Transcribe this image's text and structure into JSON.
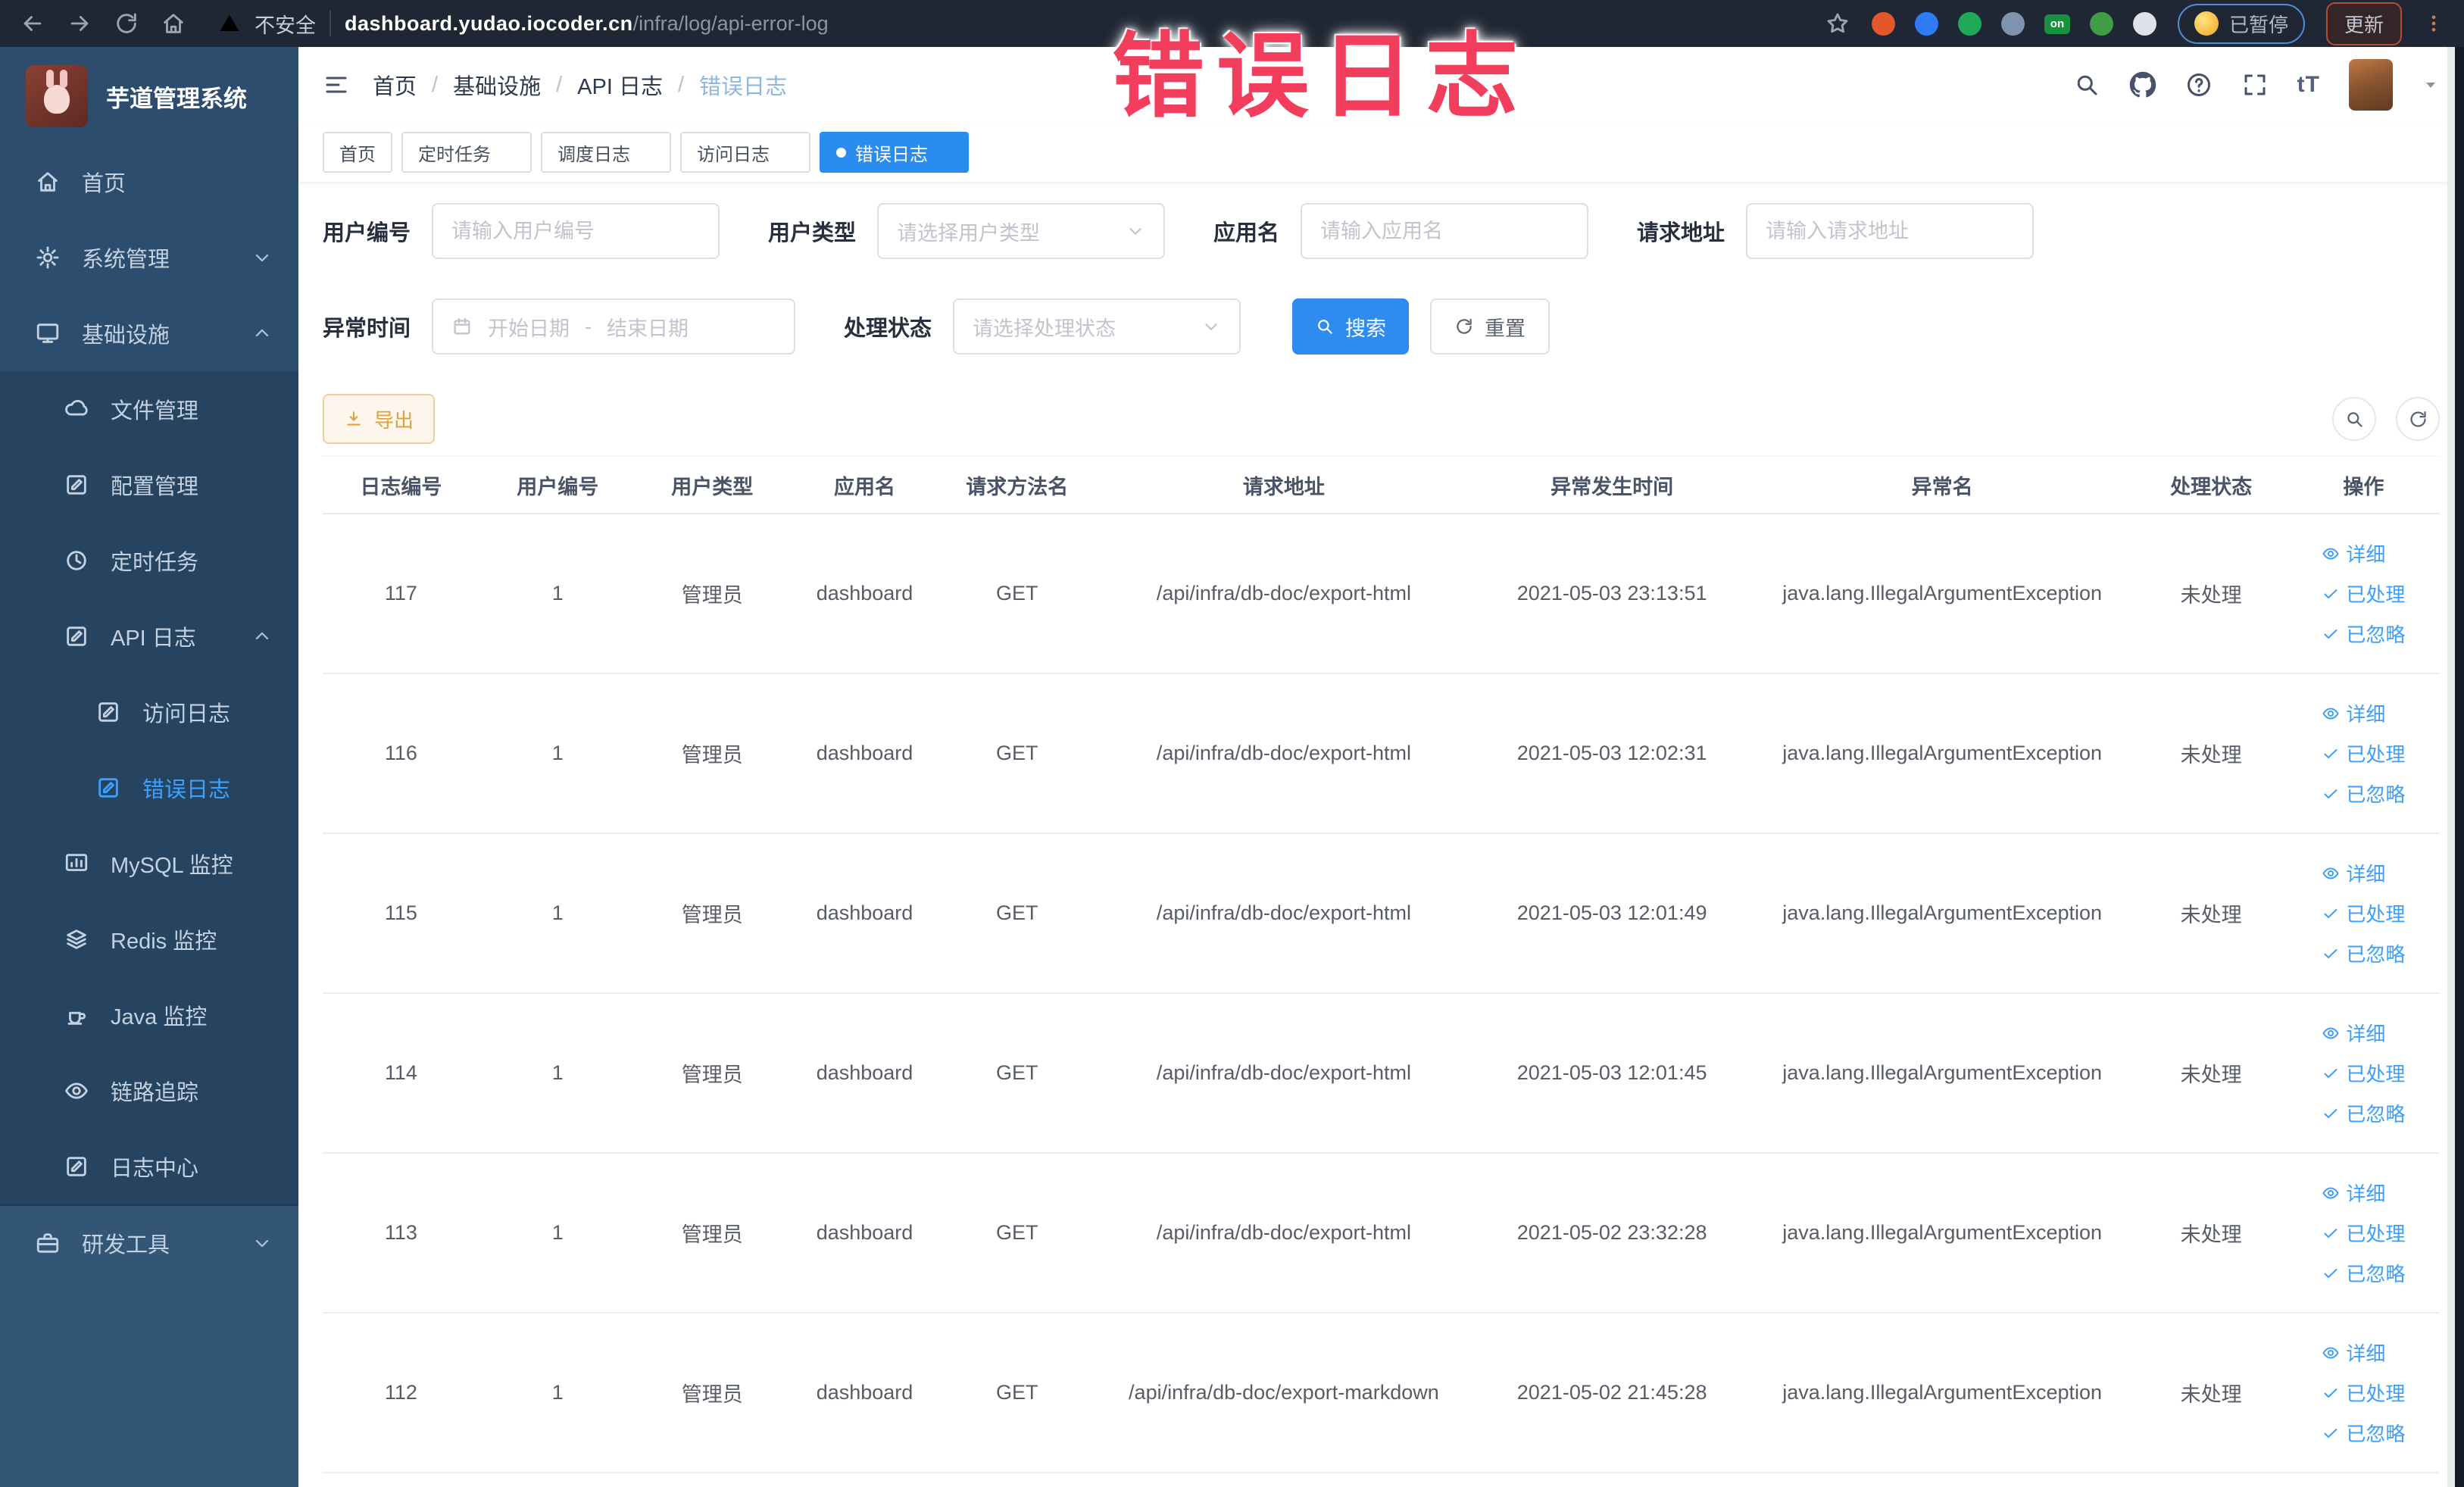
{
  "browser": {
    "security_label": "不安全",
    "url_domain": "dashboard.yudao.iocoder.cn",
    "url_path": "/infra/log/api-error-log",
    "paused_label": "已暂停",
    "update_label": "更新",
    "extensions": [
      {
        "name": "extension-icon-orange",
        "color": "#e2572b"
      },
      {
        "name": "extension-icon-shield",
        "color": "#2f7af5"
      },
      {
        "name": "extension-icon-green-v",
        "color": "#1faa59"
      },
      {
        "name": "extension-icon-grid",
        "color": "#8093ad"
      },
      {
        "name": "extension-icon-on-badge",
        "color": "#18923f",
        "label": "on"
      },
      {
        "name": "extension-icon-leaf",
        "color": "#3f9d46"
      },
      {
        "name": "extension-icon-puzzle",
        "color": "#dfe3e8"
      }
    ]
  },
  "overlay": {
    "title": "错误日志",
    "color": "#f23e5c"
  },
  "sidebar": {
    "app_title": "芋道管理系统",
    "items": [
      {
        "key": "home",
        "icon": "home",
        "label": "首页",
        "depth": 1
      },
      {
        "key": "system",
        "icon": "gear",
        "label": "系统管理",
        "depth": 1,
        "arrow": "down"
      },
      {
        "key": "infra",
        "icon": "monitor",
        "label": "基础设施",
        "depth": 1,
        "arrow": "up"
      },
      {
        "key": "file",
        "icon": "cloud",
        "label": "文件管理",
        "depth": 2
      },
      {
        "key": "config",
        "icon": "edit",
        "label": "配置管理",
        "depth": 2
      },
      {
        "key": "job",
        "icon": "clock",
        "label": "定时任务",
        "depth": 2
      },
      {
        "key": "api-log",
        "icon": "edit",
        "label": "API 日志",
        "depth": 2,
        "arrow": "up"
      },
      {
        "key": "access-log",
        "icon": "edit",
        "label": "访问日志",
        "depth": 3
      },
      {
        "key": "error-log",
        "icon": "edit",
        "label": "错误日志",
        "depth": 3,
        "active": true
      },
      {
        "key": "mysql",
        "icon": "chart",
        "label": "MySQL 监控",
        "depth": 2
      },
      {
        "key": "redis",
        "icon": "layers",
        "label": "Redis 监控",
        "depth": 2
      },
      {
        "key": "java",
        "icon": "java",
        "label": "Java 监控",
        "depth": 2
      },
      {
        "key": "tracer",
        "icon": "eye",
        "label": "链路追踪",
        "depth": 2
      },
      {
        "key": "log-center",
        "icon": "edit",
        "label": "日志中心",
        "depth": 2
      },
      {
        "key": "dev-tools",
        "icon": "tool",
        "label": "研发工具",
        "depth": 1,
        "arrow": "down",
        "section": true
      }
    ]
  },
  "header": {
    "breadcrumb": [
      "首页",
      "基础设施",
      "API 日志",
      "错误日志"
    ],
    "separator": "/"
  },
  "tabs": [
    {
      "label": "首页",
      "closable": false,
      "active": false
    },
    {
      "label": "定时任务",
      "closable": true,
      "active": false
    },
    {
      "label": "调度日志",
      "closable": true,
      "active": false
    },
    {
      "label": "访问日志",
      "closable": true,
      "active": false
    },
    {
      "label": "错误日志",
      "closable": true,
      "active": true
    }
  ],
  "filters": {
    "user_id": {
      "label": "用户编号",
      "placeholder": "请输入用户编号"
    },
    "user_type": {
      "label": "用户类型",
      "placeholder": "请选择用户类型"
    },
    "app_name": {
      "label": "应用名",
      "placeholder": "请输入应用名"
    },
    "request_url": {
      "label": "请求地址",
      "placeholder": "请输入请求地址"
    },
    "exception_time": {
      "label": "异常时间",
      "start_placeholder": "开始日期",
      "separator": "-",
      "end_placeholder": "结束日期"
    },
    "process_status": {
      "label": "处理状态",
      "placeholder": "请选择处理状态"
    },
    "search_label": "搜索",
    "reset_label": "重置"
  },
  "toolbar": {
    "export_label": "导出"
  },
  "table": {
    "headers": [
      "日志编号",
      "用户编号",
      "用户类型",
      "应用名",
      "请求方法名",
      "请求地址",
      "异常发生时间",
      "异常名",
      "处理状态",
      "操作"
    ],
    "actions": {
      "detail": "详细",
      "processed": "已处理",
      "ignored": "已忽略"
    },
    "rows": [
      {
        "id": "117",
        "user_id": "1",
        "user_type": "管理员",
        "app": "dashboard",
        "method": "GET",
        "url": "/api/infra/db-doc/export-html",
        "time": "2021-05-03 23:13:51",
        "exception": "java.lang.IllegalArgumentException",
        "status": "未处理"
      },
      {
        "id": "116",
        "user_id": "1",
        "user_type": "管理员",
        "app": "dashboard",
        "method": "GET",
        "url": "/api/infra/db-doc/export-html",
        "time": "2021-05-03 12:02:31",
        "exception": "java.lang.IllegalArgumentException",
        "status": "未处理"
      },
      {
        "id": "115",
        "user_id": "1",
        "user_type": "管理员",
        "app": "dashboard",
        "method": "GET",
        "url": "/api/infra/db-doc/export-html",
        "time": "2021-05-03 12:01:49",
        "exception": "java.lang.IllegalArgumentException",
        "status": "未处理"
      },
      {
        "id": "114",
        "user_id": "1",
        "user_type": "管理员",
        "app": "dashboard",
        "method": "GET",
        "url": "/api/infra/db-doc/export-html",
        "time": "2021-05-03 12:01:45",
        "exception": "java.lang.IllegalArgumentException",
        "status": "未处理"
      },
      {
        "id": "113",
        "user_id": "1",
        "user_type": "管理员",
        "app": "dashboard",
        "method": "GET",
        "url": "/api/infra/db-doc/export-html",
        "time": "2021-05-02 23:32:28",
        "exception": "java.lang.IllegalArgumentException",
        "status": "未处理"
      },
      {
        "id": "112",
        "user_id": "1",
        "user_type": "管理员",
        "app": "dashboard",
        "method": "GET",
        "url": "/api/infra/db-doc/export-markdown",
        "time": "2021-05-02 21:45:28",
        "exception": "java.lang.IllegalArgumentException",
        "status": "未处理"
      }
    ]
  }
}
